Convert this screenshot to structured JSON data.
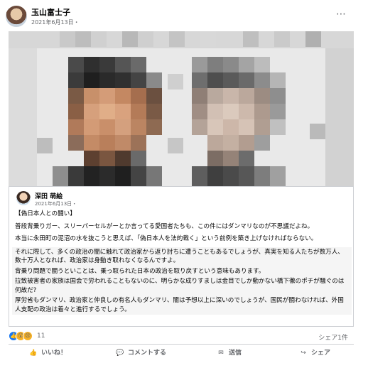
{
  "post": {
    "author": "玉山富士子",
    "date": "2021年6月13日・",
    "more_icon": "⋯"
  },
  "shared": {
    "author": "深田 萌絵",
    "date": "2021年6月13日・",
    "paragraphs": [
      "【偽日本人との闘い】",
      "普段背乗りガー、スリーパーセルがーとか言ってる愛国者たちも、この件にはダンマリなのが不思議だよね。",
      "本当に永田町の泥沼の水を抜こうと思えば、「偽日本人を法的裁く」という前例を築き上げなければならない。",
      "それに際して、多くの政治の闇に触れて政治家から返り討ちに遭うこともあるでしょうが、真実を知る人たちが数万人、数十万人となれば、政治家は身動き取れなくなるんですよ。",
      "背乗り問題で闘うといことは、乗っ取られた日本の政治を取り戻すという意味もあります。",
      "拉致被害者の家族は国会で労われることもないのに、明らかな成りすましは金目でしか動かない橋下徹のポチが騒ぐのは何故だ?",
      "厚労省もダンマリ、政治家と仲良しの有名人もダンマリ、闇は予想以上に深いのでしょうが、国民が闘わなければ、外国人支配の政治は着々と進行するでしょう。"
    ]
  },
  "reactions": {
    "count": "11",
    "shares": "シェア1件",
    "icons": [
      "like-icon",
      "wow-icon",
      "sad-icon"
    ]
  },
  "actions": {
    "like": "いいね！",
    "comment": "コメントする",
    "send": "送信",
    "share": "シェア"
  },
  "colors": {
    "accent": "#1877f2",
    "secondary_text": "#65676b",
    "border": "#ced0d4"
  }
}
